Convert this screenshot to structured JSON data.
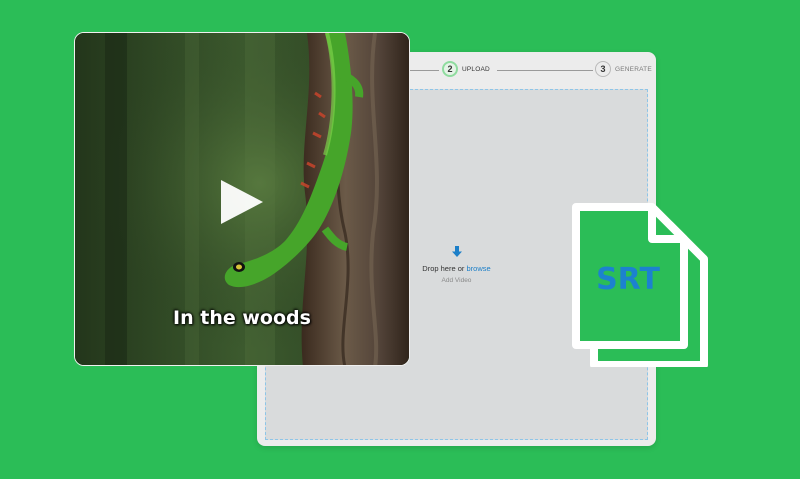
{
  "steps": [
    {
      "number": "2",
      "label": "UPLOAD",
      "active": true
    },
    {
      "number": "3",
      "label": "GENERATE",
      "active": false
    }
  ],
  "dropzone": {
    "icon": "download-arrow-icon",
    "prefix": "Drop here or",
    "link": "browse",
    "subtitle": "Add Video"
  },
  "video": {
    "caption": "In the woods",
    "play_icon": "play-icon"
  },
  "srt_file": {
    "label": "SRT",
    "icon": "document-stack-icon"
  },
  "colors": {
    "background": "#2bbd57",
    "accent": "#1c7fc8",
    "panel": "#ececec",
    "dropzone": "#d9dbdc"
  }
}
